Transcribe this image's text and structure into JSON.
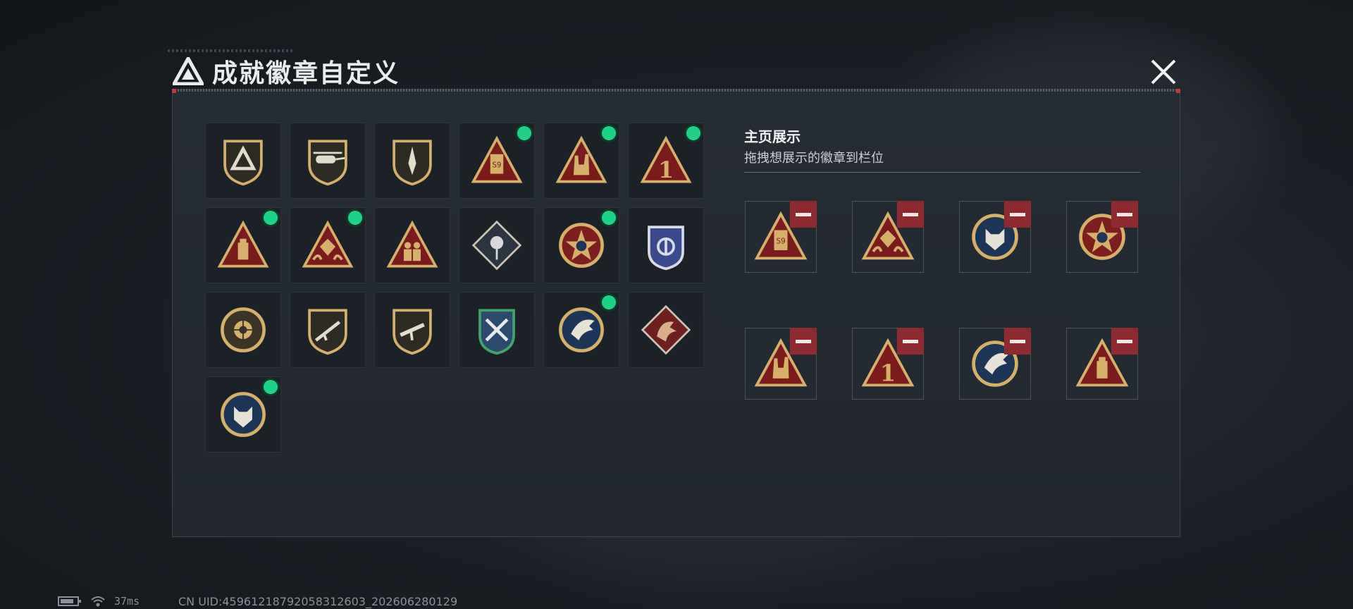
{
  "window": {
    "title": "成就徽章自定义"
  },
  "colors": {
    "accent_green": "#1fd28a",
    "remove_red": "#8c2a2f",
    "gold": "#d4b06a",
    "maroon": "#7a1c1c",
    "navy": "#1d3557"
  },
  "badges": [
    {
      "icon": "shield-triangle-badge-icon",
      "selected": false
    },
    {
      "icon": "helicopter-shield-badge-icon",
      "selected": false
    },
    {
      "icon": "dagger-shield-badge-icon",
      "selected": false
    },
    {
      "icon": "s9-triangle-badge-icon",
      "selected": true
    },
    {
      "icon": "rock-hand-triangle-badge-icon",
      "selected": true
    },
    {
      "icon": "number-one-triangle-badge-icon",
      "selected": true
    },
    {
      "icon": "usb-triangle-badge-icon",
      "selected": true
    },
    {
      "icon": "dice-hands-triangle-badge-icon",
      "selected": true
    },
    {
      "icon": "soldiers-triangle-badge-icon",
      "selected": false
    },
    {
      "icon": "rose-diamond-badge-icon",
      "selected": false
    },
    {
      "icon": "star-round-badge-icon",
      "selected": true
    },
    {
      "icon": "navy-crest-badge-icon",
      "selected": false
    },
    {
      "icon": "skull-crosshair-badge-icon",
      "selected": false
    },
    {
      "icon": "rifle-shield-badge-icon",
      "selected": false
    },
    {
      "icon": "smg-shield-badge-icon",
      "selected": false
    },
    {
      "icon": "crossed-weapons-crest-badge-icon",
      "selected": false
    },
    {
      "icon": "eagle-round-badge-icon",
      "selected": true
    },
    {
      "icon": "dragon-diamond-badge-icon",
      "selected": false
    },
    {
      "icon": "wolf-round-badge-icon",
      "selected": true
    }
  ],
  "display": {
    "title": "主页展示",
    "subtitle": "拖拽想展示的徽章到栏位",
    "slots": [
      {
        "icon": "s9-triangle-badge-icon"
      },
      {
        "icon": "dice-hands-triangle-badge-icon"
      },
      {
        "icon": "wolf-round-badge-icon"
      },
      {
        "icon": "star-round-badge-icon"
      },
      {
        "icon": "rock-hand-triangle-badge-icon"
      },
      {
        "icon": "number-one-triangle-badge-icon"
      },
      {
        "icon": "eagle-round-badge-icon"
      },
      {
        "icon": "usb-triangle-badge-icon"
      }
    ]
  },
  "status_bar": {
    "ping": "37ms",
    "uid": "CN UID:4596121879205831260‌3_202606280129"
  }
}
